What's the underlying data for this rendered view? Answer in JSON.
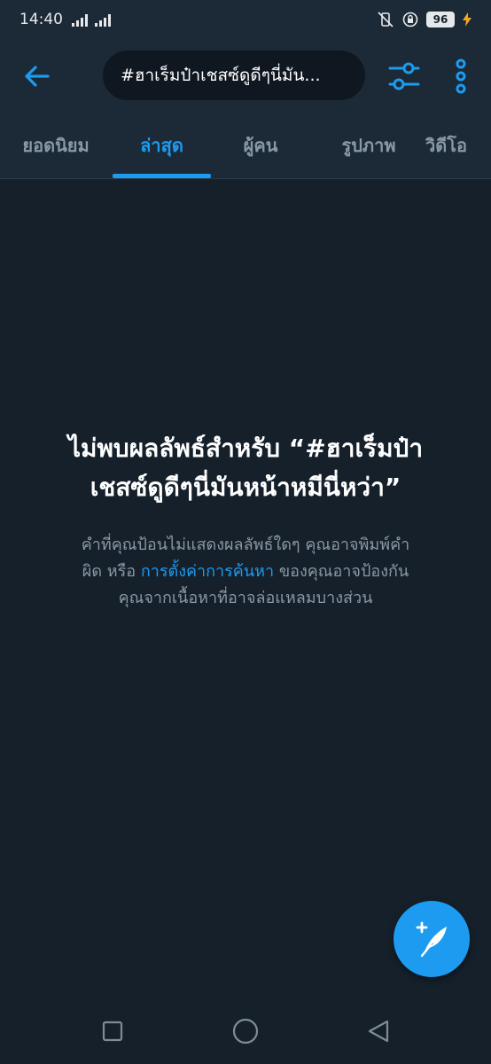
{
  "status_bar": {
    "time": "14:40",
    "battery": "96"
  },
  "header": {
    "search_query": "#ฮาเร็มป๋าเชสซ์ดูดีๆนี่มัน..."
  },
  "tabs": [
    {
      "label": "ยอดนิยม"
    },
    {
      "label": "ล่าสุด"
    },
    {
      "label": "ผู้คน"
    },
    {
      "label": "รูปภาพ"
    },
    {
      "label": "วิดีโอ"
    }
  ],
  "empty_state": {
    "title_line1": "ไม่พบผลลัพธ์สำหรับ “#ฮาเร็มป๋า",
    "title_line2": "เชสซ์ดูดีๆนี่มันหน้าหมีนี่หว่า”",
    "desc_line1": "คำที่คุณป้อนไม่แสดงผลลัพธ์ใดๆ คุณอาจพิมพ์คำ",
    "desc_pre_link": "ผิด หรือ ",
    "desc_link": "การตั้งค่าการค้นหา",
    "desc_post_link": " ของคุณอาจป้องกัน",
    "desc_line3": "คุณจากเนื้อหาที่อาจล่อแหลมบางส่วน"
  },
  "colors": {
    "accent": "#1d9bf0",
    "background": "#15202b",
    "header_bg": "#1c2a38",
    "secondary_text": "#8b98a5"
  },
  "icons": [
    "back-arrow-icon",
    "filter-sliders-icon",
    "more-vertical-icon",
    "compose-tweet-icon",
    "nav-recents-icon",
    "nav-home-icon",
    "nav-back-icon"
  ]
}
